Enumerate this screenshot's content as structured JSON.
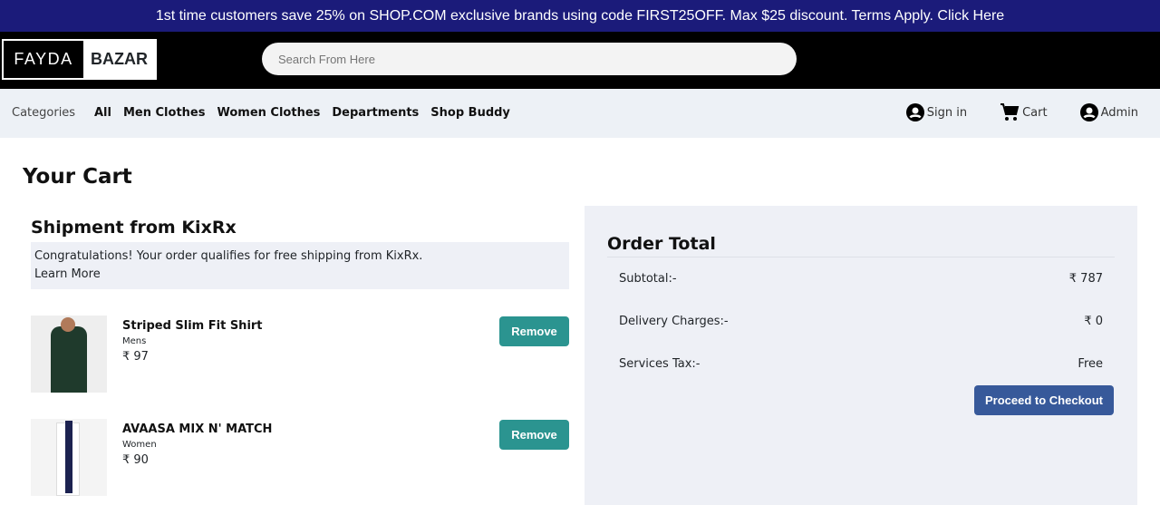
{
  "promo": "1st time customers save 25% on SHOP.COM exclusive brands using code FIRST25OFF. Max $25 discount. Terms Apply. Click Here",
  "logo": {
    "left": "FAYDA",
    "right": "BAZAR"
  },
  "search": {
    "placeholder": "Search From Here"
  },
  "nav": {
    "categories": "Categories",
    "links": [
      "All",
      "Men Clothes",
      "Women Clothes",
      "Departments",
      "Shop Buddy"
    ],
    "signin": "Sign in",
    "cart": "Cart",
    "admin": "Admin"
  },
  "title": "Your Cart",
  "shipment": {
    "title": "Shipment from KixRx",
    "note": "Congratulations! Your order qualifies for free shipping from KixRx.",
    "learn": "Learn More"
  },
  "items": [
    {
      "name": "Striped Slim Fit Shirt",
      "category": "Mens",
      "price": "₹ 97",
      "remove": "Remove"
    },
    {
      "name": "AVAASA MIX N' MATCH",
      "category": "Women",
      "price": "₹ 90",
      "remove": "Remove"
    }
  ],
  "order": {
    "title": "Order Total",
    "rows": [
      {
        "label": "Subtotal:-",
        "value": "₹ 787"
      },
      {
        "label": "Delivery Charges:-",
        "value": "₹ 0"
      },
      {
        "label": "Services Tax:-",
        "value": "Free"
      }
    ],
    "checkout": "Proceed to Checkout"
  }
}
